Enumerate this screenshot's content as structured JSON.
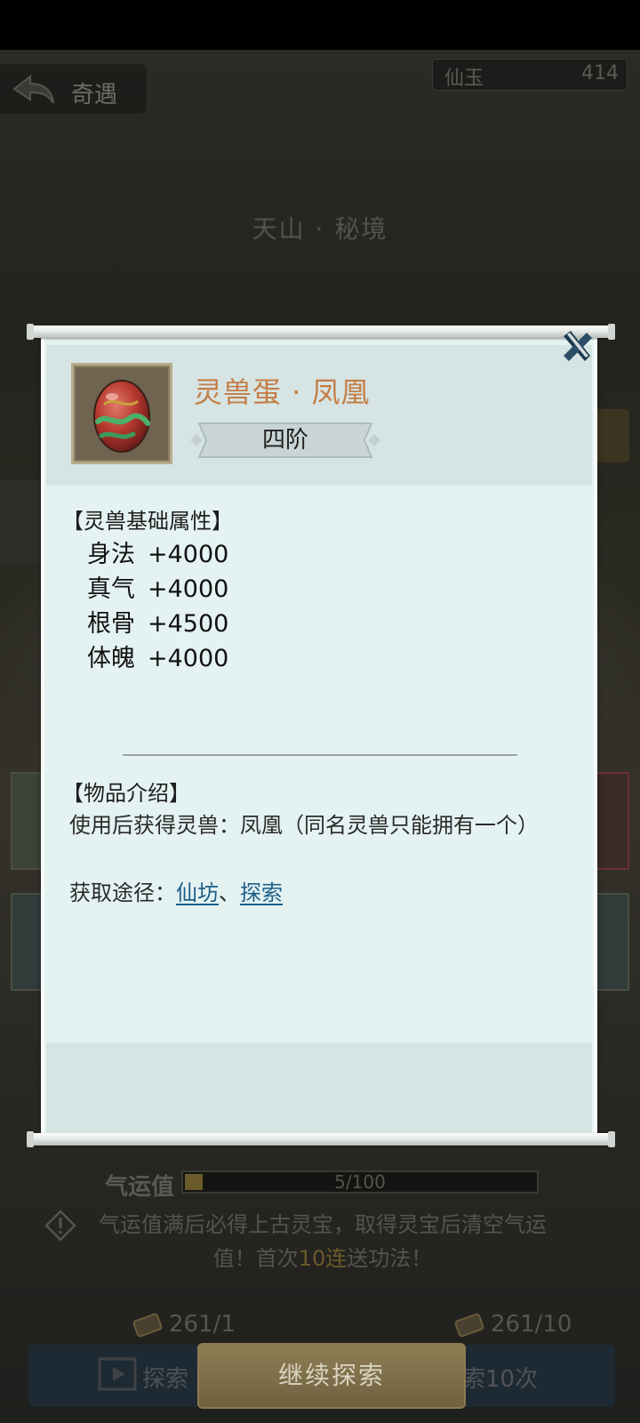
{
  "header": {
    "back_label": "奇遇",
    "currency_name": "仙玉",
    "currency_value": "414"
  },
  "location_title": "天山 · 秘境",
  "luck": {
    "label": "气运值",
    "value": 5,
    "max": 100,
    "text": "5/100"
  },
  "notice": {
    "text_part1": "气运值满后必得上古灵宝，取得灵宝后清空气运值！首次",
    "highlight": "10连",
    "text_part2": "送功法！"
  },
  "costs": {
    "single": "261/1",
    "ten": "261/10"
  },
  "buttons": {
    "explore": "探索",
    "continue": "继续探索",
    "explore_ten": "索10次"
  },
  "dialog": {
    "item_name": "灵兽蛋 · 凤凰",
    "grade": "四阶",
    "attr_section_title": "【灵兽基础属性】",
    "attributes": [
      {
        "name": "身法",
        "value": "+4000"
      },
      {
        "name": "真气",
        "value": "+4000"
      },
      {
        "name": "根骨",
        "value": "+4500"
      },
      {
        "name": "体魄",
        "value": "+4000"
      }
    ],
    "desc_section_title": "【物品介绍】",
    "description": "使用后获得灵兽：凤凰（同名灵兽只能拥有一个）",
    "source_label": "获取途径：",
    "sources": [
      "仙坊",
      "探索"
    ],
    "source_separator": "、"
  },
  "colors": {
    "paper": "#e5f2f2",
    "panel": "#d6e4e4",
    "item_name": "#c47d45",
    "link": "#1a5f8a"
  }
}
